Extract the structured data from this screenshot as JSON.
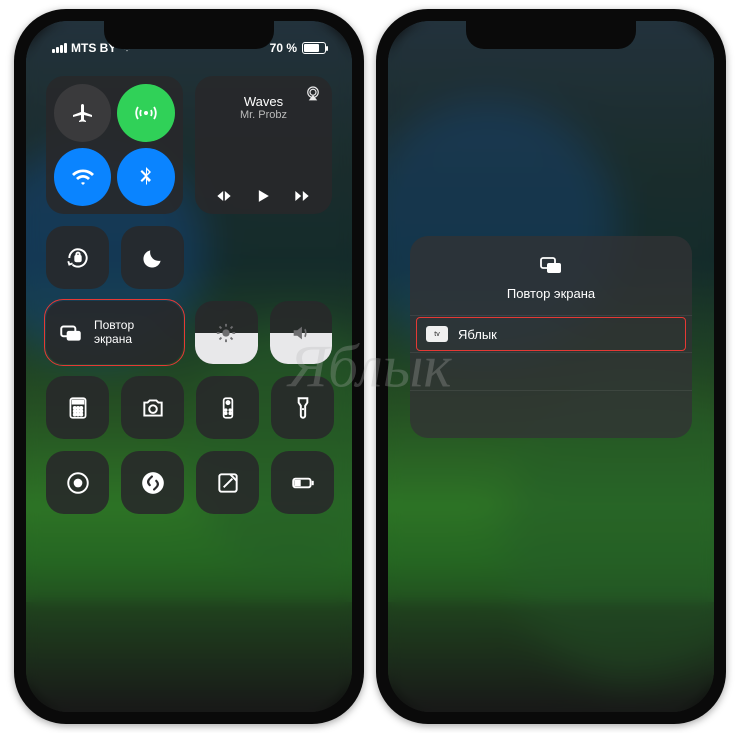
{
  "status": {
    "carrier": "MTS BY",
    "battery": "70 %"
  },
  "media": {
    "title": "Waves",
    "artist": "Mr. Probz"
  },
  "mirror": {
    "line1": "Повтор",
    "line2": "экрана"
  },
  "panel": {
    "title": "Повтор экрана",
    "device": "Яблык"
  },
  "icons": {
    "airplane": "airplane-icon",
    "antenna": "cellular-data-icon",
    "wifi": "wifi-icon",
    "bluetooth": "bluetooth-icon",
    "lock": "orientation-lock-icon",
    "moon": "do-not-disturb-icon",
    "mirror": "screen-mirroring-icon",
    "brightness": "brightness-icon",
    "volume": "volume-icon",
    "calculator": "calculator-icon",
    "camera": "camera-icon",
    "remote": "apple-tv-remote-icon",
    "flashlight": "flashlight-icon",
    "record": "screen-record-icon",
    "shazam": "shazam-icon",
    "note": "quick-note-icon",
    "lowpower": "low-power-icon",
    "airplay": "airplay-icon",
    "prev": "previous-track-icon",
    "play": "play-icon",
    "next": "next-track-icon"
  },
  "colors": {
    "highlight": "#e53935",
    "blue": "#0a84ff",
    "green": "#30d158"
  }
}
